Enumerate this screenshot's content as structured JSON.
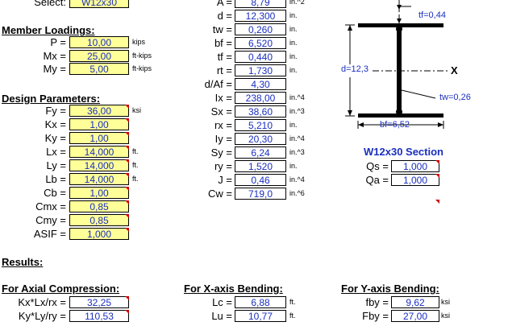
{
  "select": {
    "label": "Select:",
    "value": "W12x30"
  },
  "member_loadings": {
    "title": "Member Loadings:",
    "rows": [
      {
        "label": "P =",
        "value": "10,00",
        "unit": "kips"
      },
      {
        "label": "Mx =",
        "value": "25,00",
        "unit": "ft-kips"
      },
      {
        "label": "My =",
        "value": "5,00",
        "unit": "ft-kips"
      }
    ]
  },
  "design_parameters": {
    "title": "Design Parameters:",
    "rows": [
      {
        "label": "Fy =",
        "value": "36,00",
        "unit": "ksi"
      },
      {
        "label": "Kx =",
        "value": "1,00",
        "unit": ""
      },
      {
        "label": "Ky =",
        "value": "1,00",
        "unit": ""
      },
      {
        "label": "Lx =",
        "value": "14,000",
        "unit": "ft."
      },
      {
        "label": "Ly =",
        "value": "14,000",
        "unit": "ft."
      },
      {
        "label": "Lb =",
        "value": "14,000",
        "unit": "ft."
      },
      {
        "label": "Cb =",
        "value": "1,00",
        "unit": ""
      },
      {
        "label": "Cmx =",
        "value": "0,85",
        "unit": ""
      },
      {
        "label": "Cmy =",
        "value": "0,85",
        "unit": ""
      },
      {
        "label": "ASIF =",
        "value": "1,000",
        "unit": ""
      }
    ]
  },
  "properties": {
    "rows": [
      {
        "label": "A =",
        "value": "8,79",
        "unit": "in.^2"
      },
      {
        "label": "d =",
        "value": "12,300",
        "unit": "in."
      },
      {
        "label": "tw =",
        "value": "0,260",
        "unit": "in."
      },
      {
        "label": "bf =",
        "value": "6,520",
        "unit": "in."
      },
      {
        "label": "tf =",
        "value": "0,440",
        "unit": "in."
      },
      {
        "label": "rt =",
        "value": "1,730",
        "unit": "in."
      },
      {
        "label": "d/Af =",
        "value": "4,30",
        "unit": ""
      },
      {
        "label": "Ix =",
        "value": "238,00",
        "unit": "in.^4"
      },
      {
        "label": "Sx =",
        "value": "38,60",
        "unit": "in.^3"
      },
      {
        "label": "rx =",
        "value": "5,210",
        "unit": "in."
      },
      {
        "label": "Iy =",
        "value": "20,30",
        "unit": "in.^4"
      },
      {
        "label": "Sy =",
        "value": "6,24",
        "unit": "in.^3"
      },
      {
        "label": "ry =",
        "value": "1,520",
        "unit": "in."
      },
      {
        "label": "J =",
        "value": "0,46",
        "unit": "in.^4"
      },
      {
        "label": "Cw =",
        "value": "719,0",
        "unit": "in.^6"
      }
    ]
  },
  "section_diagram": {
    "tf_label": "tf=0,44",
    "d_label": "d=12,3",
    "x_label": "X",
    "tw_label": "tw=0,26",
    "bf_label": "bf=6,52",
    "section_title": "W12x30 Section"
  },
  "qs_qa": {
    "rows": [
      {
        "label": "Qs =",
        "value": "1,000"
      },
      {
        "label": "Qa =",
        "value": "1,000"
      }
    ]
  },
  "results": {
    "title": "Results:"
  },
  "axial": {
    "title": "For Axial Compression:",
    "rows": [
      {
        "label": "Kx*Lx/rx =",
        "value": "32,25",
        "unit": ""
      },
      {
        "label": "Ky*Ly/ry =",
        "value": "110,53",
        "unit": ""
      }
    ]
  },
  "x_bending": {
    "title": "For X-axis Bending:",
    "rows": [
      {
        "label": "Lc =",
        "value": "6,88",
        "unit": "ft."
      },
      {
        "label": "Lu =",
        "value": "10,77",
        "unit": "ft."
      }
    ]
  },
  "y_bending": {
    "title": "For Y-axis Bending:",
    "rows": [
      {
        "label": "fby =",
        "value": "9,62",
        "unit": "ksi"
      },
      {
        "label": "Fby =",
        "value": "27,00",
        "unit": "ksi"
      }
    ]
  },
  "colors": {
    "input_fill": "#ffff99",
    "value_text": "#1a2fbf",
    "marker": "#cc0000"
  }
}
